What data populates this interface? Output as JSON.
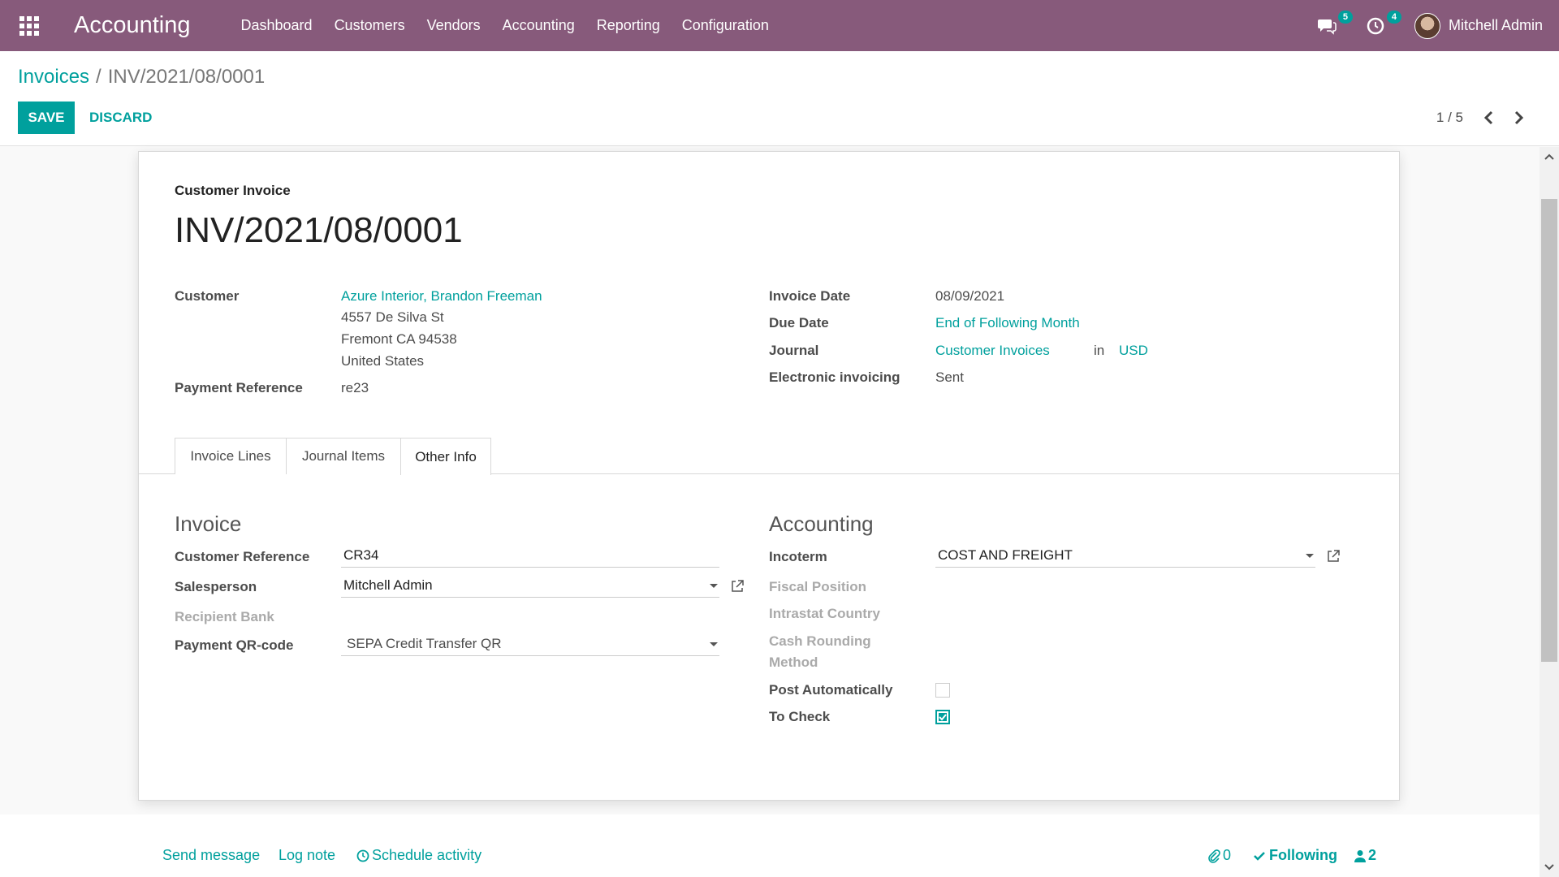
{
  "navbar": {
    "app_title": "Accounting",
    "menu": [
      "Dashboard",
      "Customers",
      "Vendors",
      "Accounting",
      "Reporting",
      "Configuration"
    ],
    "messages_count": "5",
    "activities_count": "4",
    "user_name": "Mitchell Admin"
  },
  "control": {
    "breadcrumb_parent": "Invoices",
    "breadcrumb_separator": "/",
    "breadcrumb_current": "INV/2021/08/0001",
    "save_label": "SAVE",
    "discard_label": "DISCARD",
    "pager": "1 / 5"
  },
  "invoice": {
    "type_label": "Customer Invoice",
    "number": "INV/2021/08/0001",
    "customer_label": "Customer",
    "customer_name": "Azure Interior, Brandon Freeman",
    "address_line1": "4557 De Silva St",
    "address_line2": "Fremont CA 94538",
    "address_line3": "United States",
    "payment_reference_label": "Payment Reference",
    "payment_reference": "re23",
    "invoice_date_label": "Invoice Date",
    "invoice_date": "08/09/2021",
    "due_date_label": "Due Date",
    "due_date": "End of Following Month",
    "journal_label": "Journal",
    "journal": "Customer Invoices",
    "journal_in": "in",
    "currency": "USD",
    "einvoicing_label": "Electronic invoicing",
    "einvoicing": "Sent"
  },
  "tabs": [
    "Invoice Lines",
    "Journal Items",
    "Other Info"
  ],
  "other_info": {
    "invoice_section": "Invoice",
    "customer_reference_label": "Customer Reference",
    "customer_reference": "CR34",
    "salesperson_label": "Salesperson",
    "salesperson": "Mitchell Admin",
    "recipient_bank_label": "Recipient Bank",
    "qr_label": "Payment QR-code",
    "qr_value": "SEPA Credit Transfer QR",
    "accounting_section": "Accounting",
    "incoterm_label": "Incoterm",
    "incoterm": "COST AND FREIGHT",
    "fiscal_position_label": "Fiscal Position",
    "intrastat_label": "Intrastat Country",
    "cash_rounding_label_1": "Cash Rounding",
    "cash_rounding_label_2": "Method",
    "post_auto_label": "Post Automatically",
    "to_check_label": "To Check"
  },
  "chatter": {
    "send_message": "Send message",
    "log_note": "Log note",
    "schedule_activity": "Schedule activity",
    "attachments": "0",
    "following": "Following",
    "followers": "2"
  },
  "colors": {
    "brand": "#875a7b",
    "accent": "#00a09d"
  }
}
